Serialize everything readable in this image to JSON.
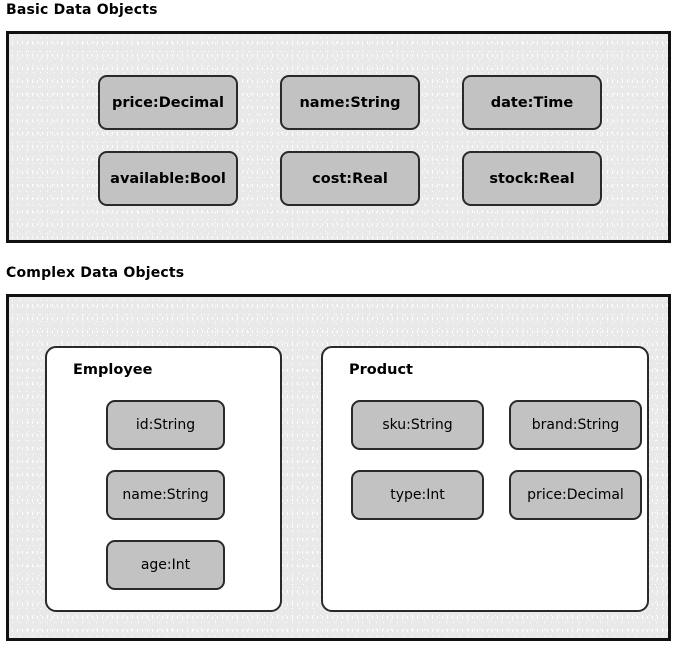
{
  "sections": {
    "basic": {
      "title": "Basic Data Objects",
      "objects": [
        {
          "label": "price:Decimal"
        },
        {
          "label": "name:String"
        },
        {
          "label": "date:Time"
        },
        {
          "label": "available:Bool"
        },
        {
          "label": "cost:Real"
        },
        {
          "label": "stock:Real"
        }
      ]
    },
    "complex": {
      "title": "Complex Data Objects",
      "groups": [
        {
          "name": "Employee",
          "fields": [
            {
              "label": "id:String"
            },
            {
              "label": "name:String"
            },
            {
              "label": "age:Int"
            }
          ]
        },
        {
          "name": "Product",
          "fields": [
            {
              "label": "sku:String"
            },
            {
              "label": "brand:String"
            },
            {
              "label": "type:Int"
            },
            {
              "label": "price:Decimal"
            }
          ]
        }
      ]
    }
  },
  "colors": {
    "chip_fill": "#c2c2c2",
    "chip_border": "#2a2a2a",
    "panel_border": "#111111",
    "panel_fill": "#e9e9e9",
    "card_fill": "#ffffff",
    "text": "#000000"
  }
}
